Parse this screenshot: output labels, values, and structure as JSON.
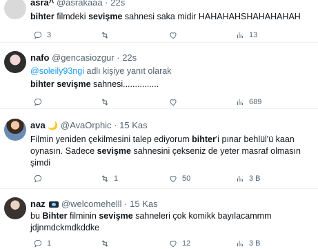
{
  "tweets": [
    {
      "name": "asra^",
      "handle": "@asrakaaa",
      "time": "22s",
      "text_parts": [
        "bihter",
        " filmdeki ",
        "sevişme",
        " sahnesi saka midir HAHAHAHSHAHAHAHAH"
      ],
      "replies": "3",
      "retweets": "",
      "likes": "",
      "views": "13"
    },
    {
      "name": "nafo",
      "handle": "@gencasiozgur",
      "time": "22s",
      "reply_to": "@soleily93ngi",
      "reply_note": " adlı kişiye yanıt olarak",
      "text_parts": [
        "bihter sevişme",
        " sahnesi..............."
      ],
      "replies": "",
      "retweets": "",
      "likes": "",
      "views": "689"
    },
    {
      "name": "ava",
      "emoji": "🌙",
      "handle": "@AvaOrphic",
      "time": "15 Kas",
      "line1_parts": [
        "Filmin yeniden çekilmesini talep ediyorum ",
        "bihter",
        "'i pınar behlül'ü kaan"
      ],
      "line2_parts": [
        "oynasın. Sadece ",
        "sevişme",
        " sahnesini çekseniz de yeter masraf olmasın"
      ],
      "line3": "şimdi",
      "replies": "",
      "retweets": "1",
      "likes": "50",
      "views": "3 B"
    },
    {
      "name": "naz",
      "emoji": "📼",
      "handle": "@welcomehelll",
      "time": "15 Kas",
      "line1_parts": [
        "bu ",
        "Bihter",
        " filminin ",
        "sevişme",
        " sahneleri çok komikk bayılacammm"
      ],
      "line2": "jdjnmdckmdkddke",
      "replies": "1",
      "retweets": "",
      "likes": "12",
      "views": "3 B"
    }
  ],
  "icons": {
    "reply": "reply-icon",
    "retweet": "retweet-icon",
    "like": "heart-icon",
    "views": "views-icon"
  }
}
